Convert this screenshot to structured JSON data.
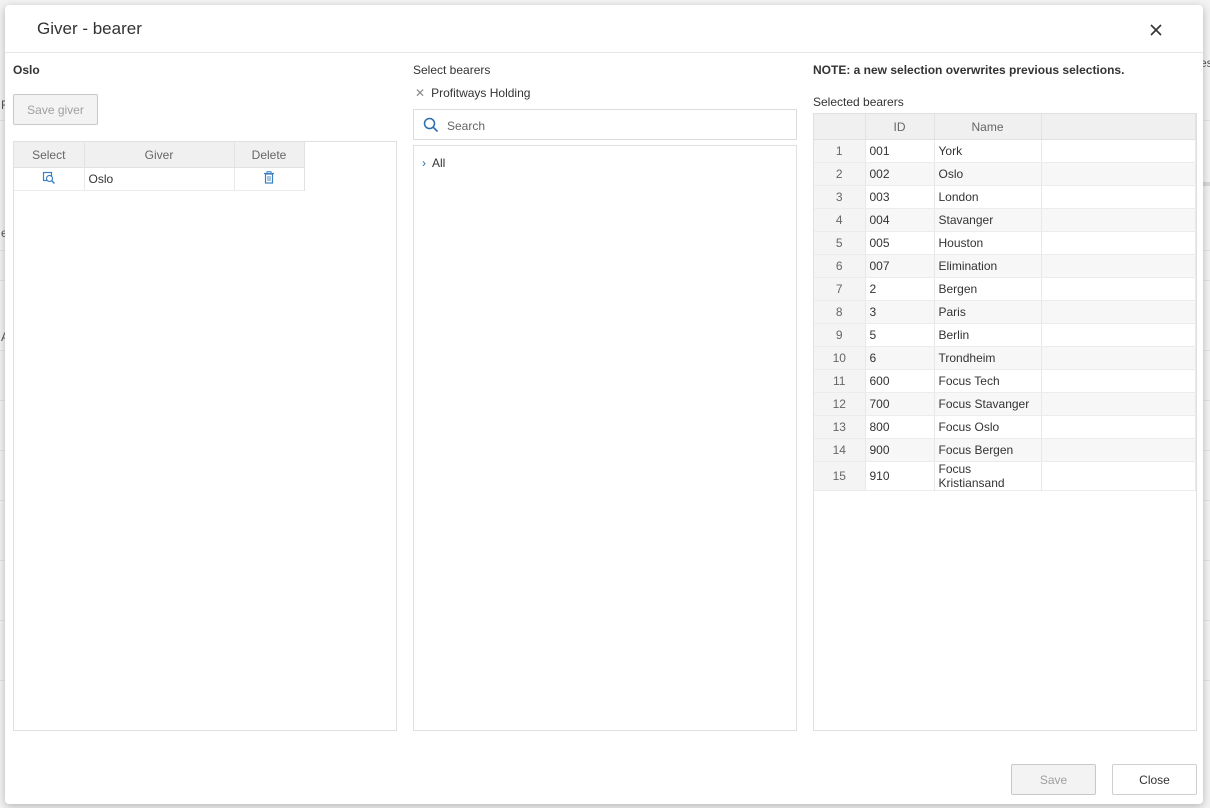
{
  "dialog": {
    "title": "Giver - bearer"
  },
  "giver_panel": {
    "title": "Oslo",
    "save_label": "Save giver",
    "columns": [
      "Select",
      "Giver",
      "Delete"
    ],
    "rows": [
      {
        "giver": "Oslo"
      }
    ]
  },
  "bearer_select": {
    "title": "Select bearers",
    "selected_tag": "Profitways Holding",
    "search_placeholder": "Search",
    "tree_root": "All"
  },
  "selected_bearers": {
    "note": "NOTE: a new selection overwrites previous selections.",
    "title": "Selected bearers",
    "columns": [
      "ID",
      "Name"
    ],
    "rows": [
      {
        "n": "1",
        "id": "001",
        "name": "York"
      },
      {
        "n": "2",
        "id": "002",
        "name": "Oslo"
      },
      {
        "n": "3",
        "id": "003",
        "name": "London"
      },
      {
        "n": "4",
        "id": "004",
        "name": "Stavanger"
      },
      {
        "n": "5",
        "id": "005",
        "name": "Houston"
      },
      {
        "n": "6",
        "id": "007",
        "name": "Elimination"
      },
      {
        "n": "7",
        "id": "2",
        "name": "Bergen"
      },
      {
        "n": "8",
        "id": "3",
        "name": "Paris"
      },
      {
        "n": "9",
        "id": "5",
        "name": "Berlin"
      },
      {
        "n": "10",
        "id": "6",
        "name": "Trondheim"
      },
      {
        "n": "11",
        "id": "600",
        "name": "Focus Tech"
      },
      {
        "n": "12",
        "id": "700",
        "name": "Focus Stavanger"
      },
      {
        "n": "13",
        "id": "800",
        "name": "Focus Oslo"
      },
      {
        "n": "14",
        "id": "900",
        "name": "Focus Bergen"
      },
      {
        "n": "15",
        "id": "910",
        "name": "Focus Kristiansand"
      }
    ]
  },
  "footer": {
    "save_label": "Save",
    "close_label": "Close"
  },
  "background_fragments": [
    "F",
    "e",
    "A",
    "es"
  ],
  "colors": {
    "accent": "#2b6cb0",
    "icon_blue": "#3a7fc1"
  },
  "icons": [
    "close-icon",
    "search-icon",
    "chevron-right-icon",
    "select-search-icon",
    "trash-icon"
  ]
}
